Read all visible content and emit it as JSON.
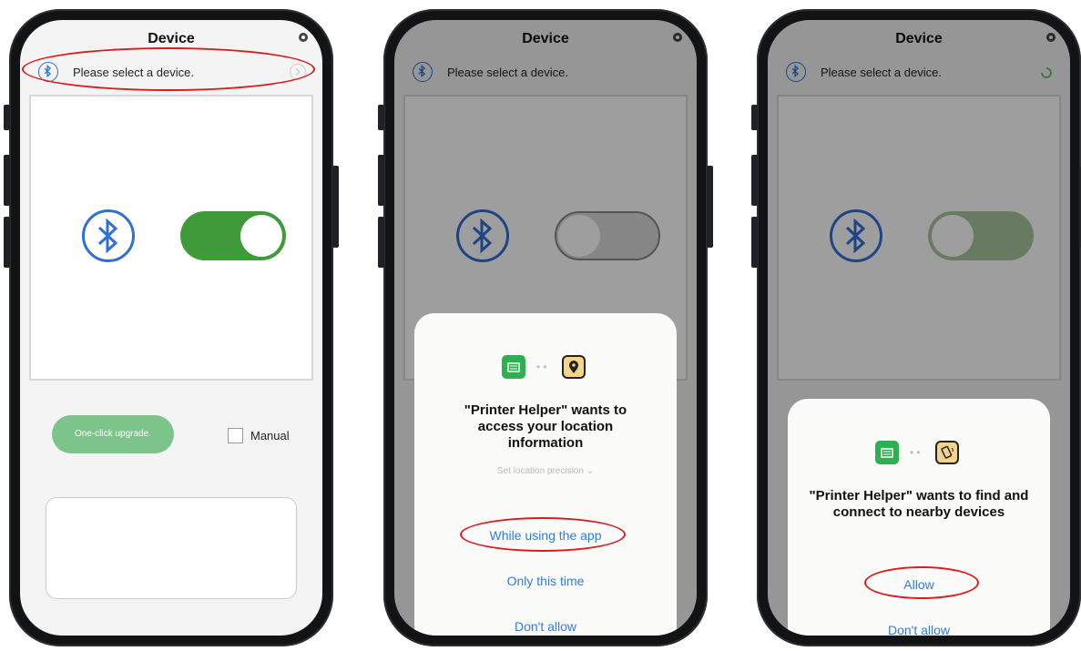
{
  "colors": {
    "bluetooth": "#2f6fd6",
    "toggle_on": "#3f9a3a",
    "toggle_off": "#8f8f8f",
    "link": "#2f7de0",
    "highlight": "#e01919",
    "upgrade_button": "#7dc48a"
  },
  "screens": [
    {
      "header": {
        "title": "Device",
        "settings_icon": "gear-icon"
      },
      "device_bar": {
        "text": "Please select a device.",
        "icon": "bluetooth-icon",
        "trailing": "chevron-right-icon"
      },
      "bluetooth_toggle": {
        "state": "on"
      },
      "upgrade_button": "One-click upgrade.",
      "manual_checkbox": {
        "label": "Manual",
        "checked": false
      },
      "log_box": ""
    },
    {
      "header": {
        "title": "Device",
        "settings_icon": "gear-icon"
      },
      "device_bar": {
        "text": "Please select a device."
      },
      "bluetooth_toggle": {
        "state": "off"
      },
      "dialog": {
        "title": "\"Printer Helper\" wants to access your location information",
        "precision": "Set location precision",
        "options": [
          "While using the app",
          "Only this time",
          "Don't allow"
        ]
      }
    },
    {
      "header": {
        "title": "Device",
        "settings_icon": "gear-icon"
      },
      "device_bar": {
        "text": "Please select a device.",
        "trailing": "loading-spinner-icon"
      },
      "bluetooth_toggle": {
        "state": "off"
      },
      "dialog": {
        "title": "\"Printer Helper\" wants to find and connect to nearby devices",
        "options": [
          "Allow",
          "Don't allow"
        ]
      }
    }
  ]
}
